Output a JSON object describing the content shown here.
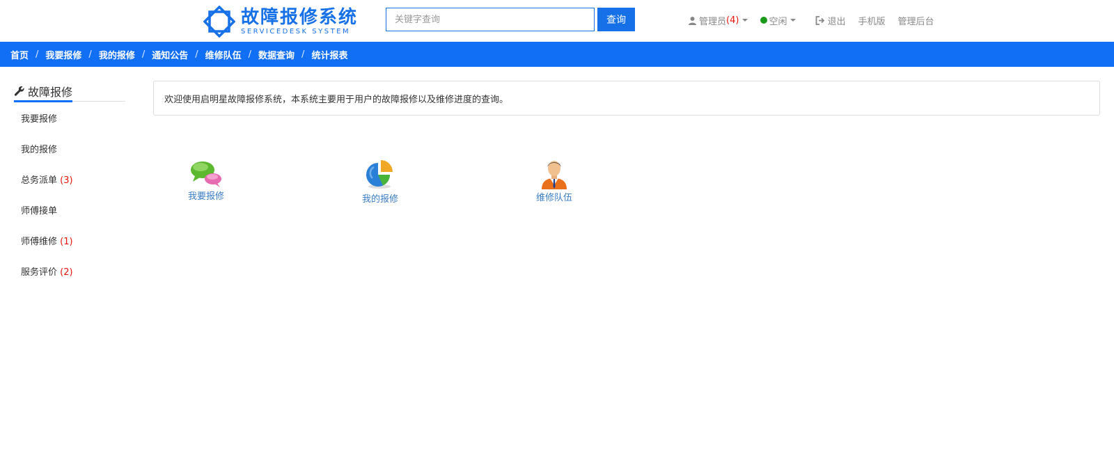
{
  "logo": {
    "title": "故障报修系统",
    "subtitle": "SERVICEDESK SYSTEM",
    "brand_color": "#1671e8"
  },
  "search": {
    "placeholder": "关键字查询",
    "value": "",
    "button_label": "查询"
  },
  "topnav": {
    "user": {
      "label": "管理员",
      "count": "(4)",
      "icon": "user-icon"
    },
    "status": {
      "label": "空闲",
      "icon": "status-dot-icon",
      "color": "#1a9a1a"
    },
    "logout": {
      "label": "退出",
      "icon": "logout-icon"
    },
    "mobile": "手机版",
    "admin": "管理后台"
  },
  "breadcrumb": {
    "items": [
      "首页",
      "我要报修",
      "我的报修",
      "通知公告",
      "维修队伍",
      "数据查询",
      "统计报表"
    ],
    "separator": "/",
    "bar_color": "#116ff5"
  },
  "sidebar": {
    "title": "故障报修",
    "title_icon": "wrench-icon",
    "items": [
      {
        "label": "我要报修",
        "count": ""
      },
      {
        "label": "我的报修",
        "count": ""
      },
      {
        "label": "总务派单",
        "count": "(3)"
      },
      {
        "label": "师傅接单",
        "count": ""
      },
      {
        "label": "师傅维修",
        "count": "(1)"
      },
      {
        "label": "服务评价",
        "count": "(2)"
      }
    ]
  },
  "main": {
    "notice": "欢迎使用启明星故障报修系统，本系统主要用于用户的故障报修以及维修进度的查询。",
    "shortcuts": [
      {
        "label": "我要报修",
        "icon": "chat-bubbles-icon"
      },
      {
        "label": "我的报修",
        "icon": "pie-chart-icon"
      },
      {
        "label": "维修队伍",
        "icon": "person-icon"
      }
    ]
  }
}
